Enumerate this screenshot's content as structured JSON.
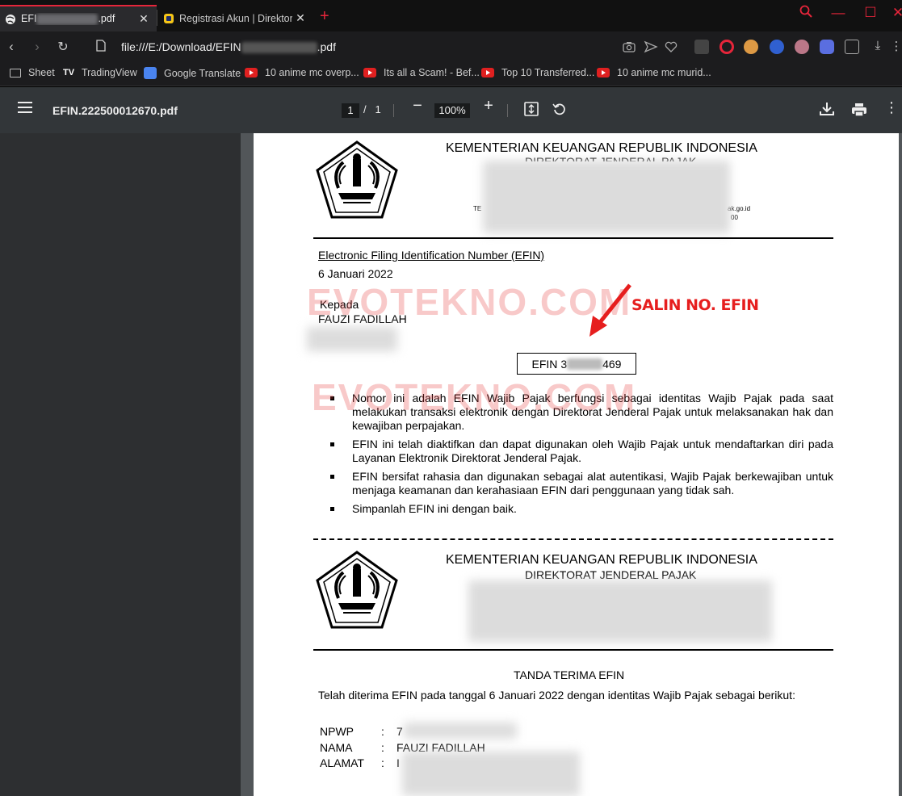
{
  "browser": {
    "tabs": [
      {
        "prefix": "EFI",
        "suffix": ".pdf",
        "active": true
      },
      {
        "title": "Registrasi Akun | Direktorat",
        "active": false
      }
    ],
    "address": {
      "prefix": "file:///E:/Download/EFIN",
      "suffix": ".pdf"
    },
    "bookmarks": [
      "Sheet",
      "TradingView",
      "Google Translate",
      "10 anime mc overp...",
      "Its all a Scam! - Bef...",
      "Top 10 Transferred...",
      "10 anime mc murid..."
    ],
    "colors": {
      "accent": "#e6253a",
      "toolbar": "#323639",
      "viewer_bg": "#525659"
    }
  },
  "pdf_viewer": {
    "file_name": "EFIN.222500012670.pdf",
    "page_current": "1",
    "page_separator": "/",
    "page_total": "1",
    "zoom": "100%"
  },
  "document": {
    "header": {
      "ministry": "KEMENTERIAN KEUANGAN REPUBLIK INDONESIA",
      "directorate": "DIREKTORAT JENDERAL PAJAK",
      "contact_left": "TE",
      "contact_right_1": "ak.go.id",
      "contact_right_2": "00"
    },
    "subject": "Electronic Filing Identification Number (EFIN)",
    "date": "6 Januari 2022",
    "to_label": "Kepada",
    "recipient": "FAUZI FADILLAH",
    "efin_prefix": "EFIN",
    "efin_visible_1": "3",
    "efin_visible_2": "469",
    "points": [
      "Nomor ini adalah EFIN Wajib Pajak berfungsi sebagai identitas Wajib Pajak pada saat melakukan transaksi elektronik dengan Direktorat Jenderal Pajak untuk melaksanakan hak dan kewajiban perpajakan.",
      "EFIN ini telah diaktifkan dan dapat digunakan oleh Wajib Pajak untuk mendaftarkan diri pada Layanan Elektronik Direktorat Jenderal Pajak.",
      "EFIN bersifat rahasia dan digunakan sebagai alat autentikasi, Wajib Pajak berkewajiban untuk menjaga keamanan dan kerahasiaan EFIN dari penggunaan yang tidak sah.",
      "Simpanlah EFIN ini dengan baik."
    ],
    "receipt": {
      "ministry": "KEMENTERIAN KEUANGAN REPUBLIK INDONESIA",
      "directorate": "DIREKTORAT JENDERAL PAJAK",
      "title": "TANDA TERIMA EFIN",
      "intro": "Telah diterima EFIN pada tanggal 6 Januari 2022 dengan identitas Wajib Pajak sebagai berikut:",
      "fields": [
        {
          "label": "NPWP",
          "sep": ":",
          "value": "7"
        },
        {
          "label": "NAMA",
          "sep": ":",
          "value": "FAUZI FADILLAH"
        },
        {
          "label": "ALAMAT",
          "sep": ":",
          "value": "I"
        }
      ]
    },
    "watermark": "EVOTEKNO.COM",
    "annotation": "SALIN NO. EFIN",
    "annotation_color": "#e61e1e"
  }
}
